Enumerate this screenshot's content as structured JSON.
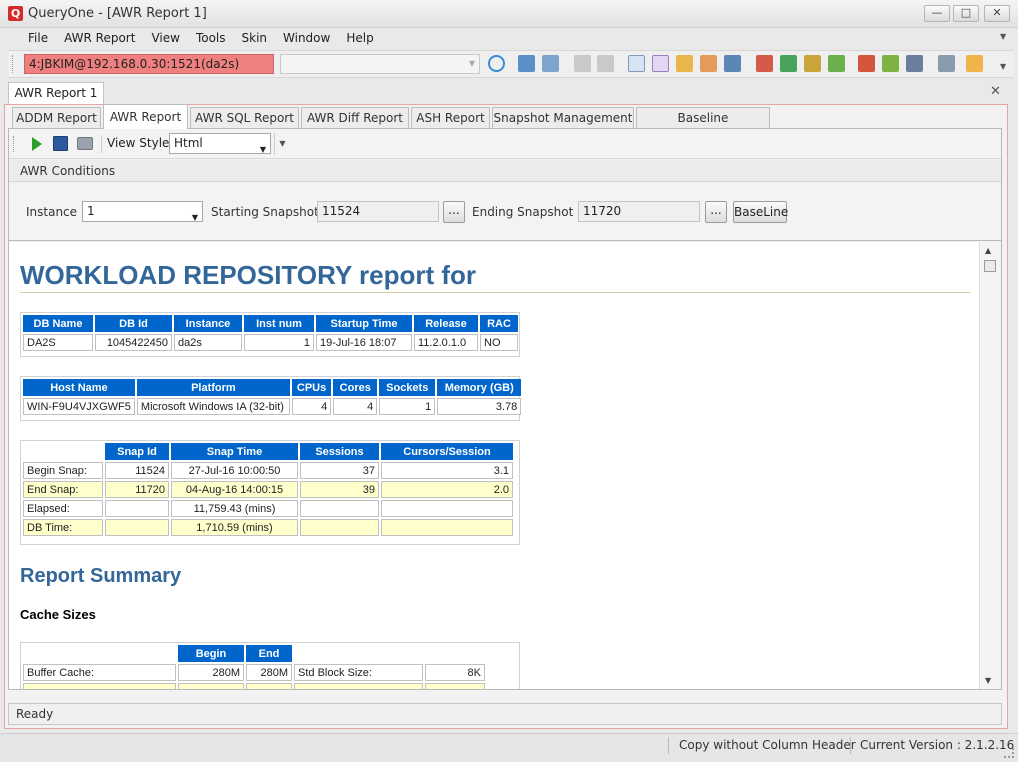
{
  "window": {
    "app_logo": "Q",
    "title": "QueryOne - [AWR Report 1]",
    "minimize": "—",
    "restore": "□",
    "close": "✕"
  },
  "menu": [
    "File",
    "AWR Report",
    "View",
    "Tools",
    "Skin",
    "Window",
    "Help"
  ],
  "connection": {
    "value": "4:JBKIM@192.168.0.30:1521(da2s)",
    "color": "#f08080"
  },
  "document_tab": {
    "label": "AWR Report 1",
    "close": "✕"
  },
  "subtabs": [
    {
      "label": "ADDM Report",
      "active": false
    },
    {
      "label": "AWR Report",
      "active": true
    },
    {
      "label": "AWR SQL Report",
      "active": false
    },
    {
      "label": "AWR Diff Report",
      "active": false
    },
    {
      "label": "ASH Report",
      "active": false
    },
    {
      "label": "Snapshot Management",
      "active": false
    },
    {
      "label": "Baseline Management",
      "active": false
    }
  ],
  "view_style": {
    "label": "View Style",
    "value": "Html"
  },
  "conditions": {
    "header": "AWR Conditions",
    "instance_label": "Instance",
    "instance_value": "1",
    "start_label": "Starting Snapshot",
    "start_value": "11524",
    "end_label": "Ending Snapshot",
    "end_value": "11720",
    "browse": "...",
    "baseline_button": "BaseLine"
  },
  "report": {
    "title": "WORKLOAD REPOSITORY report for",
    "db_table": {
      "headers": [
        "DB Name",
        "DB Id",
        "Instance",
        "Inst num",
        "Startup Time",
        "Release",
        "RAC"
      ],
      "row": [
        "DA2S",
        "1045422450",
        "da2s",
        "1",
        "19-Jul-16 18:07",
        "11.2.0.1.0",
        "NO"
      ]
    },
    "host_table": {
      "headers": [
        "Host Name",
        "Platform",
        "CPUs",
        "Cores",
        "Sockets",
        "Memory (GB)"
      ],
      "row": [
        "WIN-F9U4VJXGWF5",
        "Microsoft Windows IA (32-bit)",
        "4",
        "4",
        "1",
        "3.78"
      ]
    },
    "snap_table": {
      "headers": [
        "",
        "Snap Id",
        "Snap Time",
        "Sessions",
        "Cursors/Session"
      ],
      "rows": [
        [
          "Begin Snap:",
          "11524",
          "27-Jul-16 10:00:50",
          "37",
          "3.1"
        ],
        [
          "End Snap:",
          "11720",
          "04-Aug-16 14:00:15",
          "39",
          "2.0"
        ],
        [
          "Elapsed:",
          "",
          "11,759.43 (mins)",
          "",
          ""
        ],
        [
          "DB Time:",
          "",
          "1,710.59 (mins)",
          "",
          ""
        ]
      ]
    },
    "summary_title": "Report Summary",
    "cache_title": "Cache Sizes",
    "cache_table": {
      "headers": [
        "",
        "Begin",
        "End",
        "",
        ""
      ],
      "rows": [
        [
          "Buffer Cache:",
          "280M",
          "280M",
          "Std Block Size:",
          "8K"
        ],
        [
          "",
          "",
          "",
          "",
          ""
        ]
      ]
    }
  },
  "status": {
    "ready": "Ready",
    "copy_mode": "Copy without Column Header",
    "version": "Current Version : 2.1.2.16"
  }
}
